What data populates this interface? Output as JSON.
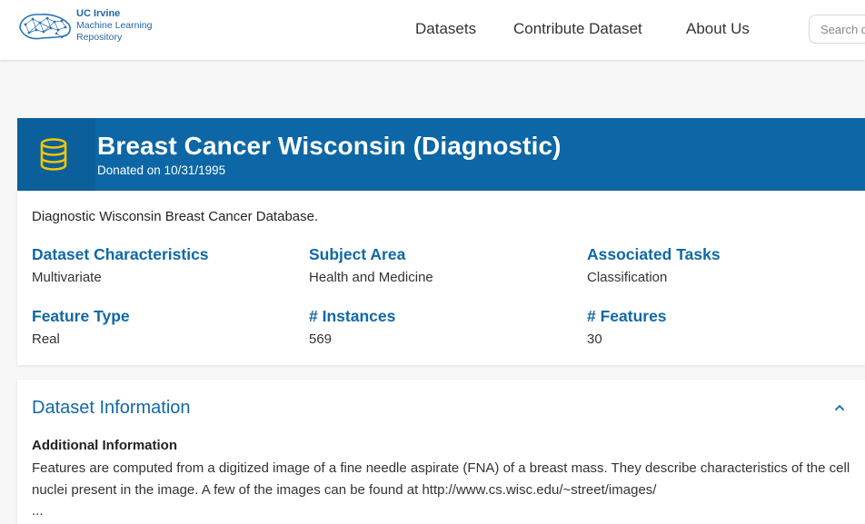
{
  "header": {
    "logo": {
      "line1": "UC Irvine",
      "line2": "Machine Learning",
      "line3": "Repository",
      "icon": "brain-network-icon"
    },
    "nav": [
      {
        "label": "Datasets"
      },
      {
        "label": "Contribute Dataset"
      },
      {
        "label": "About Us"
      }
    ],
    "search": {
      "placeholder": "Search datasets...",
      "value": ""
    }
  },
  "banner": {
    "icon": "database-icon",
    "title": "Breast Cancer Wisconsin (Diagnostic)",
    "donated": "Donated on 10/31/1995"
  },
  "summary": {
    "description": "Diagnostic Wisconsin Breast Cancer Database.",
    "properties": [
      {
        "label": "Dataset Characteristics",
        "value": "Multivariate"
      },
      {
        "label": "Subject Area",
        "value": "Health and Medicine"
      },
      {
        "label": "Associated Tasks",
        "value": "Classification"
      },
      {
        "label": "Feature Type",
        "value": "Real"
      },
      {
        "label": "# Instances",
        "value": "569"
      },
      {
        "label": "# Features",
        "value": "30"
      }
    ]
  },
  "dataset_information": {
    "heading": "Dataset Information",
    "subheading": "Additional Information",
    "text": "Features are computed from a digitized image of a fine needle aspirate (FNA) of a breast mass.  They describe characteristics of the cell nuclei present in the image. A few of the images can be found at http://www.cs.wisc.edu/~street/images/",
    "ellipsis": "...",
    "toggle_icon": "chevron-up-icon"
  },
  "colors": {
    "brand_blue": "#0d67a6",
    "link_blue": "#1168a6",
    "db_icon_yellow": "#f2c500"
  }
}
